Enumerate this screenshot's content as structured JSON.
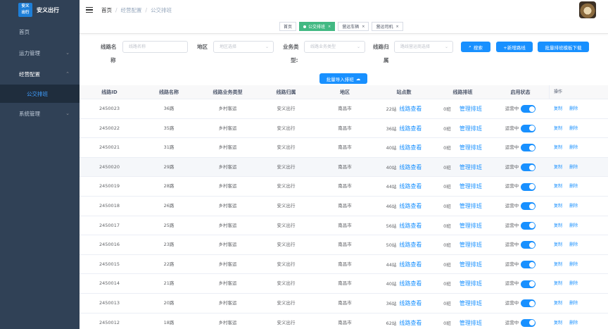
{
  "brand": {
    "logo_text": "安义出行",
    "title": "安义出行"
  },
  "sidebar": {
    "items": [
      {
        "label": "首页"
      },
      {
        "label": "运力管理"
      },
      {
        "label": "经营配置"
      },
      {
        "label": "公交排班"
      },
      {
        "label": "系统管理"
      }
    ]
  },
  "header": {
    "breadcrumb": [
      "首页",
      "经营配置",
      "公交排班"
    ],
    "breadcrumb_sep": "/"
  },
  "tags": [
    {
      "label": "首页"
    },
    {
      "label": "公交排班"
    },
    {
      "label": "营运车辆"
    },
    {
      "label": "营运司机"
    }
  ],
  "filters": {
    "route_name_label_1": "线路名",
    "route_name_label_2": "称",
    "route_name_placeholder": "线路名称",
    "region_label": "地区",
    "region_placeholder": "地区选择",
    "biz_type_label_1": "业务类",
    "biz_type_label_2": "型:",
    "biz_type_placeholder": "线路业务类型",
    "owner_label_1": "线路归",
    "owner_label_2": "属",
    "owner_placeholder": "路线营运商选择",
    "search_button": "搜索",
    "add_button": "+新增路线",
    "template_button": "批量排班模板下载",
    "import_button": "批量导入排班"
  },
  "table": {
    "columns": [
      "线路ID",
      "线路名称",
      "线路业务类型",
      "线路归属",
      "地区",
      "站点数",
      "线路排班",
      "启用状态",
      "操作"
    ],
    "rows": [
      {
        "id": "2450023",
        "name": "36路",
        "type": "乡村客运",
        "owner": "安义出行",
        "region": "南昌市",
        "stations": "22站",
        "view": "线路查看",
        "shifts": "0班",
        "manage": "管理排班",
        "status": "运营中",
        "copy": "复制",
        "delete": "删除"
      },
      {
        "id": "2450022",
        "name": "35路",
        "type": "乡村客运",
        "owner": "安义出行",
        "region": "南昌市",
        "stations": "36站",
        "view": "线路查看",
        "shifts": "0班",
        "manage": "管理排班",
        "status": "运营中",
        "copy": "复制",
        "delete": "删除"
      },
      {
        "id": "2450021",
        "name": "31路",
        "type": "乡村客运",
        "owner": "安义出行",
        "region": "南昌市",
        "stations": "40站",
        "view": "线路查看",
        "shifts": "0班",
        "manage": "管理排班",
        "status": "运营中",
        "copy": "复制",
        "delete": "删除"
      },
      {
        "id": "2450020",
        "name": "29路",
        "type": "乡村客运",
        "owner": "安义出行",
        "region": "南昌市",
        "stations": "40站",
        "view": "线路查看",
        "shifts": "0班",
        "manage": "管理排班",
        "status": "运营中",
        "copy": "复制",
        "delete": "删除"
      },
      {
        "id": "2450019",
        "name": "28路",
        "type": "乡村客运",
        "owner": "安义出行",
        "region": "南昌市",
        "stations": "44站",
        "view": "线路查看",
        "shifts": "0班",
        "manage": "管理排班",
        "status": "运营中",
        "copy": "复制",
        "delete": "删除"
      },
      {
        "id": "2450018",
        "name": "26路",
        "type": "乡村客运",
        "owner": "安义出行",
        "region": "南昌市",
        "stations": "46站",
        "view": "线路查看",
        "shifts": "0班",
        "manage": "管理排班",
        "status": "运营中",
        "copy": "复制",
        "delete": "删除"
      },
      {
        "id": "2450017",
        "name": "25路",
        "type": "乡村客运",
        "owner": "安义出行",
        "region": "南昌市",
        "stations": "56站",
        "view": "线路查看",
        "shifts": "0班",
        "manage": "管理排班",
        "status": "运营中",
        "copy": "复制",
        "delete": "删除"
      },
      {
        "id": "2450016",
        "name": "23路",
        "type": "乡村客运",
        "owner": "安义出行",
        "region": "南昌市",
        "stations": "50站",
        "view": "线路查看",
        "shifts": "0班",
        "manage": "管理排班",
        "status": "运营中",
        "copy": "复制",
        "delete": "删除"
      },
      {
        "id": "2450015",
        "name": "22路",
        "type": "乡村客运",
        "owner": "安义出行",
        "region": "南昌市",
        "stations": "44站",
        "view": "线路查看",
        "shifts": "0班",
        "manage": "管理排班",
        "status": "运营中",
        "copy": "复制",
        "delete": "删除"
      },
      {
        "id": "2450014",
        "name": "21路",
        "type": "乡村客运",
        "owner": "安义出行",
        "region": "南昌市",
        "stations": "40站",
        "view": "线路查看",
        "shifts": "0班",
        "manage": "管理排班",
        "status": "运营中",
        "copy": "复制",
        "delete": "删除"
      },
      {
        "id": "2450013",
        "name": "20路",
        "type": "乡村客运",
        "owner": "安义出行",
        "region": "南昌市",
        "stations": "36站",
        "view": "线路查看",
        "shifts": "0班",
        "manage": "管理排班",
        "status": "运营中",
        "copy": "复制",
        "delete": "删除"
      },
      {
        "id": "2450012",
        "name": "18路",
        "type": "乡村客运",
        "owner": "安义出行",
        "region": "南昌市",
        "stations": "62站",
        "view": "线路查看",
        "shifts": "0班",
        "manage": "管理排班",
        "status": "运营中",
        "copy": "复制",
        "delete": "删除"
      }
    ]
  },
  "colors": {
    "sidebar_bg": "#304156",
    "primary": "#1890ff",
    "tag_active": "#42b983"
  }
}
